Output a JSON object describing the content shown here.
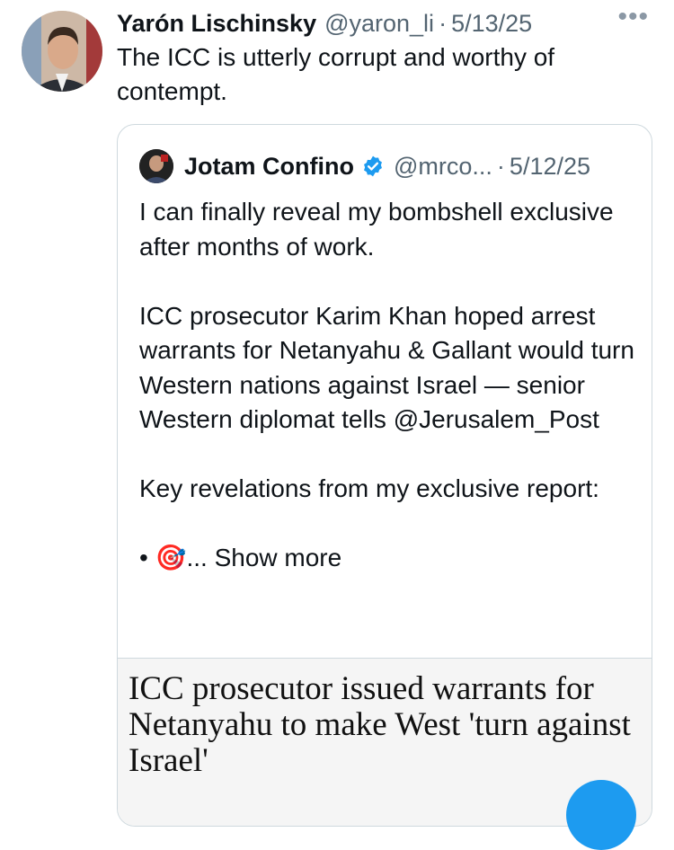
{
  "tweet": {
    "author_name": "Yarón Lischinsky",
    "handle": "@yaron_li",
    "separator": "·",
    "date": "5/13/25",
    "more_icon": "more-horizontal-icon",
    "text": "The ICC is utterly corrupt and worthy of contempt."
  },
  "quoted_tweet": {
    "author_name": "Jotam Confino",
    "verified_icon": "verified-badge-icon",
    "handle": "@mrco...",
    "separator": "·",
    "date": "5/12/25",
    "paragraphs": [
      "I can finally reveal my bombshell exclusive after months of work.",
      "ICC prosecutor Karim Khan hoped arrest warrants for Netanyahu & Gallant would turn Western nations against Israel — senior Western diplomat tells @Jerusalem_Post",
      "Key revelations from my exclusive report:"
    ],
    "last_line_prefix": "• 🎯",
    "show_more": "... Show more",
    "link_card": {
      "title": "ICC prosecutor issued warrants for Netanyahu to make West 'turn against Israel'"
    }
  },
  "colors": {
    "text": "#0f1419",
    "muted": "#536471",
    "border": "#cfd9de",
    "verified": "#1d9bf0",
    "card_bg": "#f5f5f5"
  }
}
